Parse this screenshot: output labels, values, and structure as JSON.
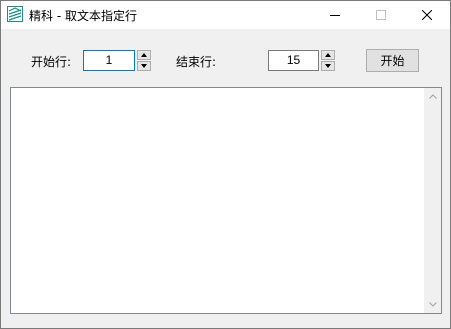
{
  "window": {
    "title": "精科 - 取文本指定行",
    "icon": "app-logo-icon",
    "controls": [
      "minimize-icon",
      "maximize-icon",
      "close-icon"
    ]
  },
  "form": {
    "start_label": "开始行:",
    "start_value": "1",
    "end_label": "结束行:",
    "end_value": "15",
    "start_button_label": "开始"
  },
  "output": {
    "text": ""
  },
  "colors": {
    "focus_border": "#0078d7",
    "window_bg": "#f0f0f0",
    "button_bg": "#e1e1e1"
  }
}
